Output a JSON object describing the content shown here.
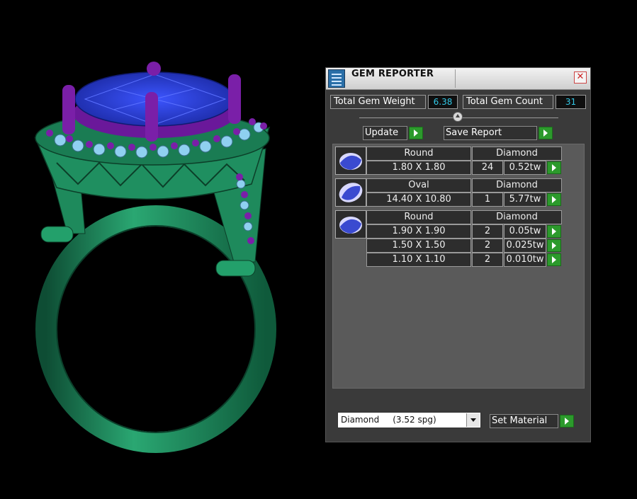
{
  "panel": {
    "title": "GEM REPORTER",
    "close_symbol": "✕",
    "total_weight_label": "Total Gem Weight",
    "total_weight_value": "6.38",
    "total_count_label": "Total Gem Count",
    "total_count_value": "31",
    "update_label": "Update",
    "save_report_label": "Save Report",
    "material_value": "Diamond     (3.52 spg)",
    "set_material_label": "Set Material"
  },
  "gem_groups": [
    {
      "icon": "gem-round-icon",
      "shape": "Round",
      "material": "Diamond",
      "rows": [
        {
          "size": "1.80 X 1.80",
          "count": "24",
          "weight": "0.52tw"
        }
      ]
    },
    {
      "icon": "gem-oval-icon",
      "shape": "Oval",
      "material": "Diamond",
      "rows": [
        {
          "size": "14.40 X 10.80",
          "count": "1",
          "weight": "5.77tw"
        }
      ]
    },
    {
      "icon": "gem-round-icon",
      "shape": "Round",
      "material": "Diamond",
      "rows": [
        {
          "size": "1.90 X 1.90",
          "count": "2",
          "weight": "0.05tw"
        },
        {
          "size": "1.50 X 1.50",
          "count": "2",
          "weight": "0.025tw"
        },
        {
          "size": "1.10 X 1.10",
          "count": "2",
          "weight": "0.010tw"
        }
      ]
    }
  ],
  "colors": {
    "ring_metal": "#1f8a5a",
    "prongs": "#7a1fa8",
    "center_stone": "#2a3fd0",
    "accent_stones": "#8fd0f0",
    "go_button": "#2c9a2c",
    "value_text": "#32c8e6"
  }
}
